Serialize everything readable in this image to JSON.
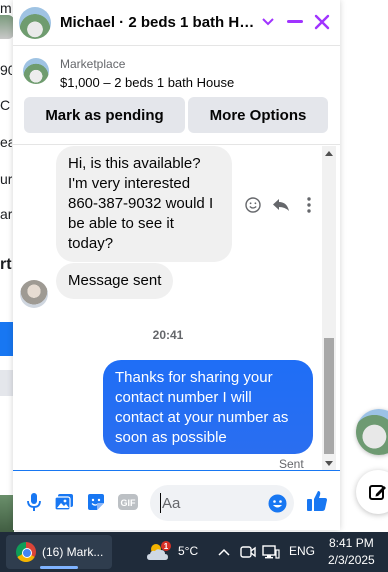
{
  "background_page": {
    "fragments": [
      "m",
      "90",
      "C",
      "ea",
      "ur",
      "ark",
      "rt"
    ]
  },
  "chat": {
    "header": {
      "title": "Michael · 2 beds 1 bath House",
      "chevron_icon": "chevron-down-icon",
      "minimize_icon": "minimize-icon",
      "close_icon": "close-icon"
    },
    "listing": {
      "source": "Marketplace",
      "title": "$1,000 – 2 beds 1 bath House"
    },
    "actions": {
      "mark_pending": "Mark as pending",
      "more_options": "More Options"
    },
    "messages": {
      "incoming_1": "Hi, is this available? I'm very interested 860-387-9032 would I be able to see it today?",
      "incoming_2": "Message sent",
      "timestamp": "20:41",
      "outgoing_1": "Thanks for sharing your contact number I will contact at your number as soon as possible",
      "status": "Sent"
    },
    "composer": {
      "placeholder": "Aa"
    }
  },
  "taskbar": {
    "app_label": "(16) Mark...",
    "weather_badge": "1",
    "temperature": "5°C",
    "language": "ENG",
    "time": "8:41 PM",
    "date": "2/3/2025"
  },
  "colors": {
    "messenger_accent": "#a033ff",
    "outgoing_bubble": "#1f6ef6",
    "taskbar": "#1f2b3a"
  }
}
